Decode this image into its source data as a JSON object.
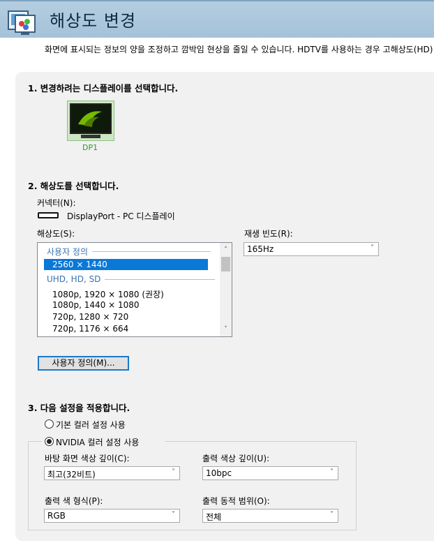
{
  "header": {
    "title": "해상도 변경",
    "icon": "display-settings-icon"
  },
  "description": "화면에 표시되는 정보의 양을 조정하고 깜박임 현상을 줄일 수 있습니다. HDTV를 사용하는 경우 고해상도(HD) 포",
  "section1": {
    "title": "1. 변경하려는 디스플레이를 선택합니다.",
    "display_label": "DP1",
    "display_icon": "nvidia-monitor-icon"
  },
  "section2": {
    "title": "2. 해상도를 선택합니다.",
    "connector_label": "커넥터(N):",
    "connector_value": "DisplayPort - PC 디스플레이",
    "connector_icon": "displayport-icon",
    "resolution_label": "해상도(S):",
    "refresh_label": "재생 빈도(R):",
    "refresh_value": "165Hz",
    "list": {
      "group1": "사용자 정의",
      "selected": "2560 × 1440",
      "group2": "UHD, HD, SD",
      "items": [
        "1080p, 1920 × 1080 (권장)",
        "1080p, 1440 × 1080",
        "720p, 1280 × 720",
        "720p, 1176 × 664"
      ]
    },
    "customize_button": "사용자 정의(M)..."
  },
  "section3": {
    "title": "3. 다음 설정을 적용합니다.",
    "radio_default": "기본 컬러 설정 사용",
    "radio_nvidia": "NVIDIA 컬러 설정 사용",
    "selected_radio": "nvidia",
    "desktop_depth_label": "바탕 화면 색상 깊이(C):",
    "desktop_depth_value": "최고(32비트)",
    "output_depth_label": "출력 색상 깊이(U):",
    "output_depth_value": "10bpc",
    "output_format_label": "출력 색 형식(P):",
    "output_format_value": "RGB",
    "output_range_label": "출력 동적 범위(O):",
    "output_range_value": "전체"
  }
}
